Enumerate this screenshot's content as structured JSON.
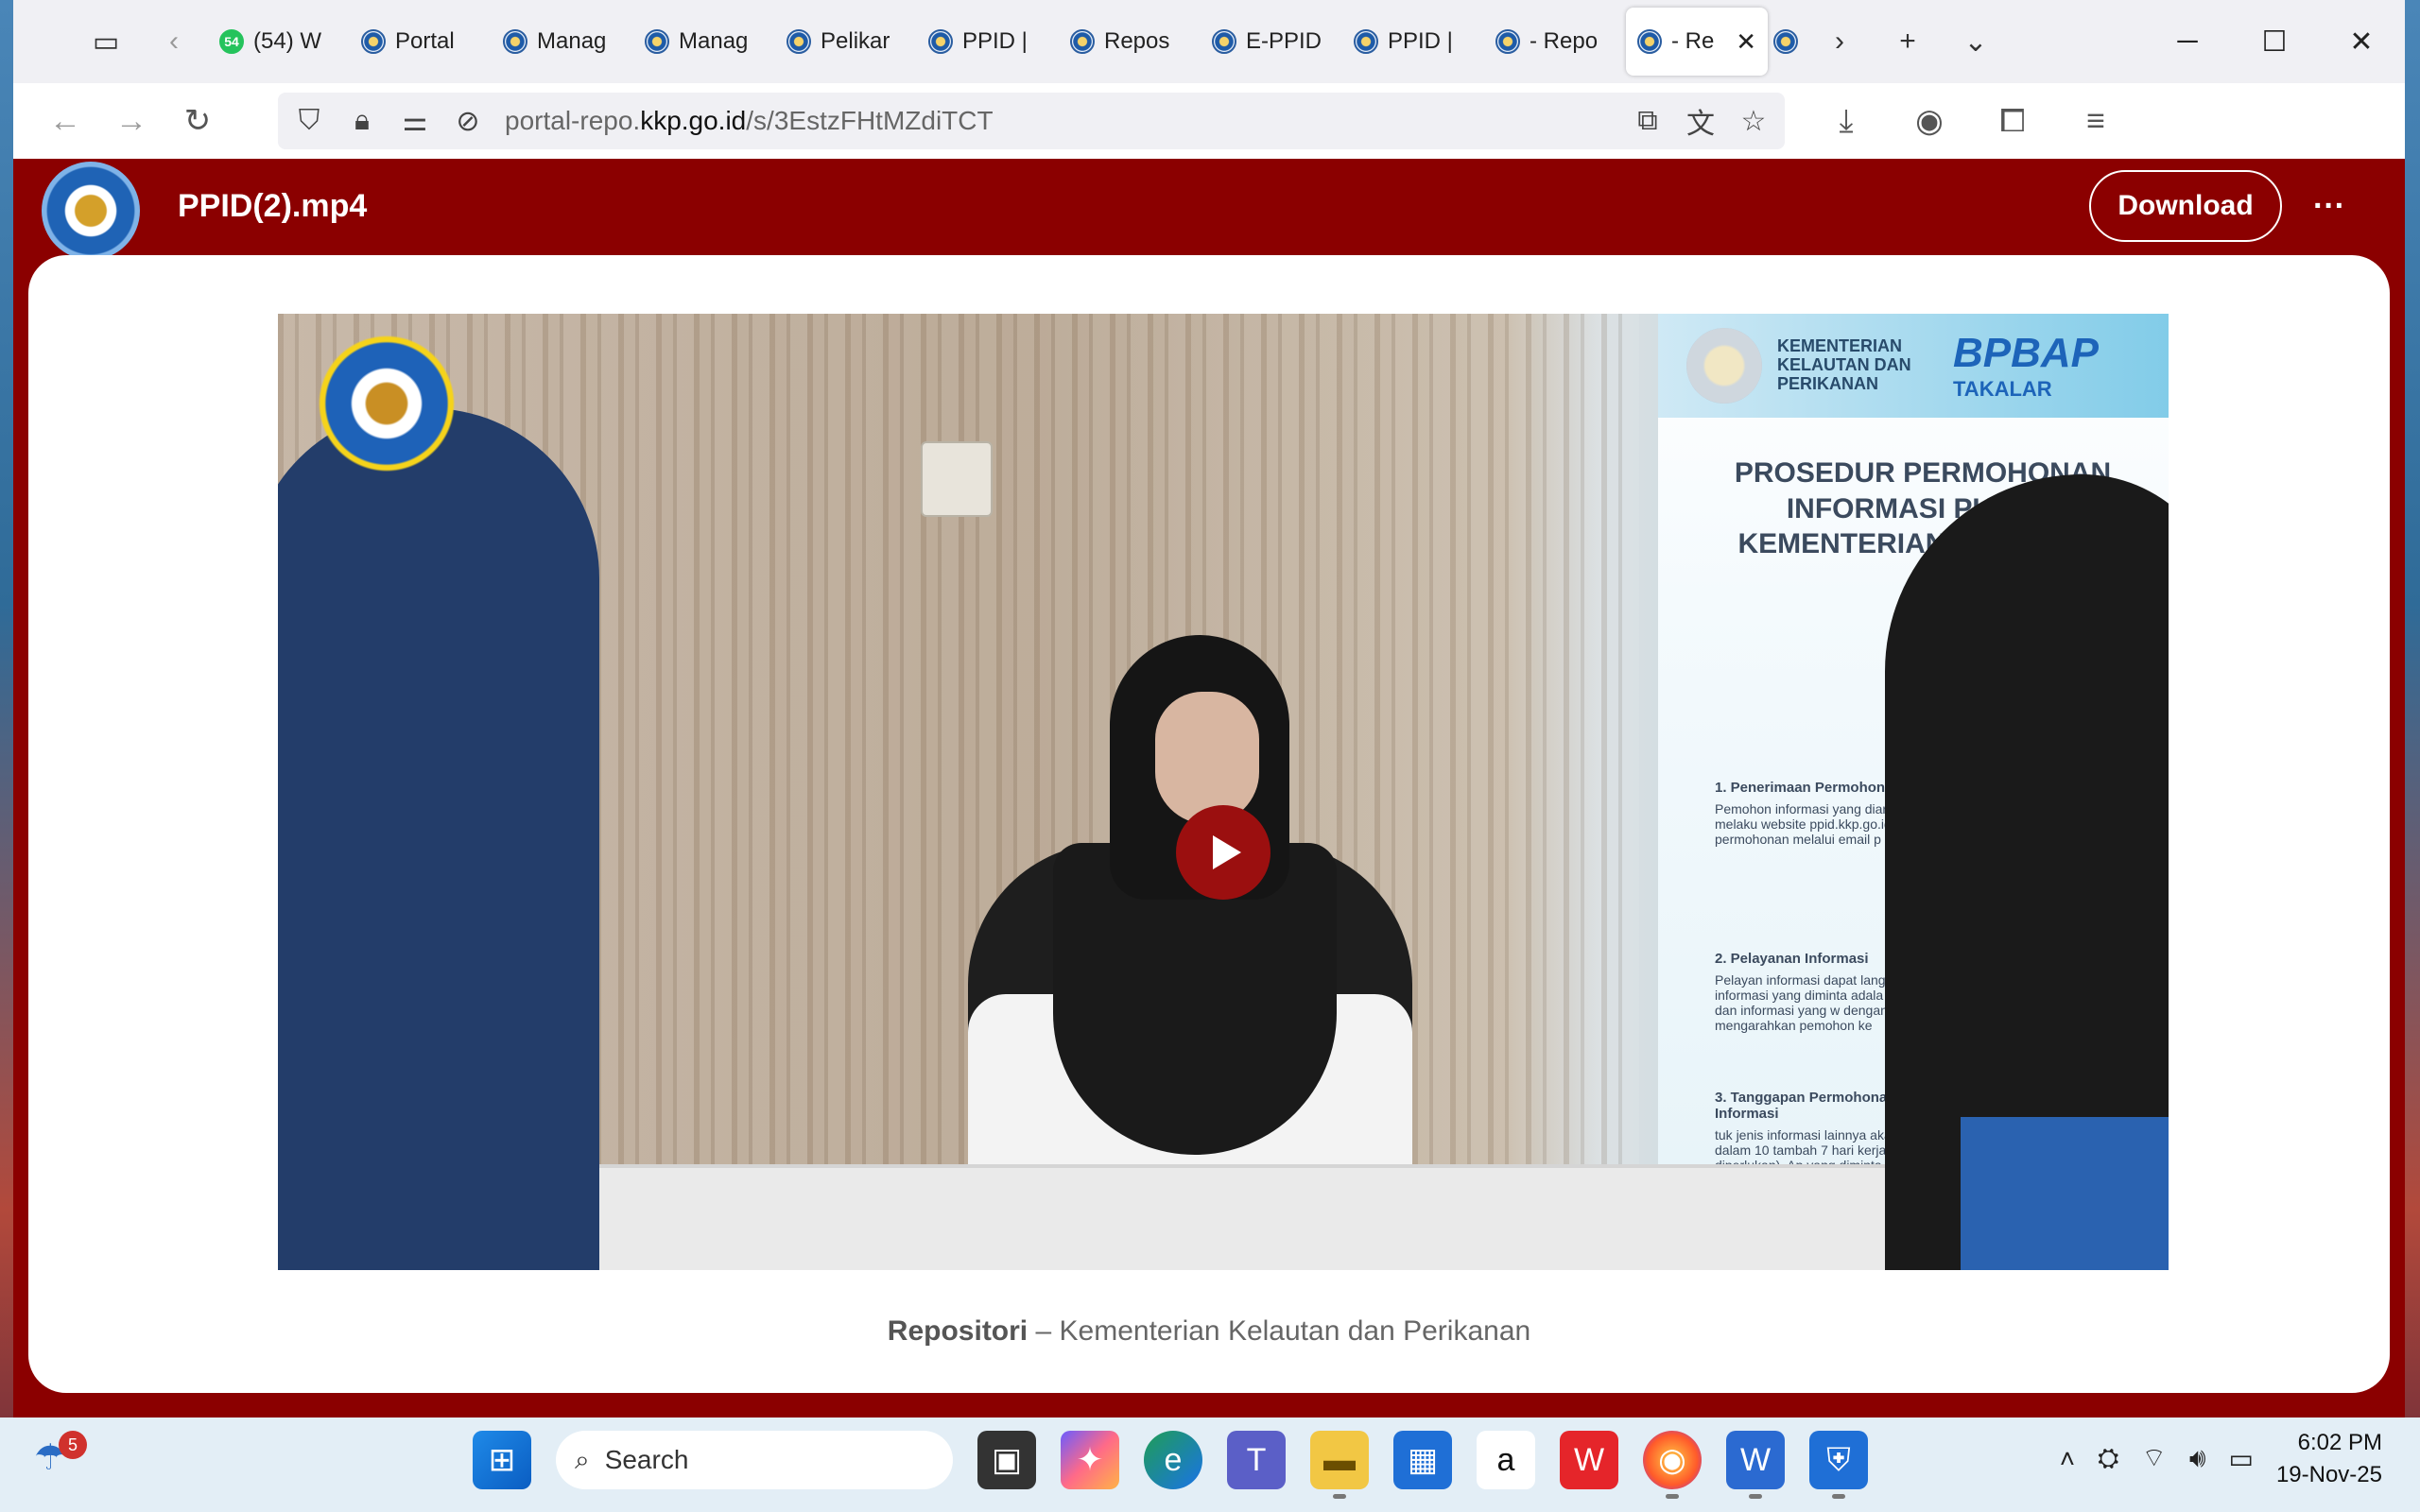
{
  "browser": {
    "tabs": [
      {
        "label": "(54) W",
        "icon": "whatsapp",
        "badge": "54",
        "active": false
      },
      {
        "label": "Portal",
        "icon": "kkp-logo",
        "active": false
      },
      {
        "label": "Manag",
        "icon": "kkp-logo",
        "active": false
      },
      {
        "label": "Manag",
        "icon": "kkp-logo",
        "active": false
      },
      {
        "label": "Pelikar",
        "icon": "kkp-logo",
        "active": false
      },
      {
        "label": "PPID |",
        "icon": "kkp-logo",
        "active": false
      },
      {
        "label": "Repos",
        "icon": "kkp-logo",
        "active": false
      },
      {
        "label": "E-PPID",
        "icon": "kkp-logo",
        "active": false
      },
      {
        "label": "PPID |",
        "icon": "kkp-logo",
        "active": false
      },
      {
        "label": "- Repo",
        "icon": "kkp-logo",
        "active": false
      },
      {
        "label": "- Re",
        "icon": "kkp-logo",
        "active": true
      }
    ],
    "url_prefix": "portal-repo.",
    "url_domain": "kkp.go.id",
    "url_path": "/s/3EstzFHtMZdiTCT"
  },
  "page": {
    "title": "PPID(2).mp4",
    "download_label": "Download",
    "more_label": "···",
    "caption_bold": "Repositori",
    "caption_rest": " – Kementerian Kelautan dan Perikanan"
  },
  "video": {
    "banner_org": "KEMENTERIAN KELAUTAN DAN PERIKANAN",
    "banner_brand": "BPBAP",
    "banner_sub": "TAKALAR",
    "banner_heading": "PROSEDUR PERMOHONAN INFORMASI PUBLIK KEMENTERIAN KELAUTAN",
    "step1_title": "1. Penerimaan Permohonan",
    "step1_text": "Pemohon informasi yang diarahkan untuk melaku website ppid.kkp.go.id. Per permohonan melalui email p",
    "step2_title": "2. Pelayanan Informasi",
    "step2_text": "Pelayan informasi dapat langsu jika informasi yang diminta adala serta merta dan informasi yang w dengan mengarahkan pemohon ke",
    "step3_title": "3. Tanggapan Permohonan Informasi",
    "step3_text": "tuk jenis informasi lainnya akan diproses dalam 10 tambah 7 hari kerja apabila diperlukan). Ap yang diminta termasuk dalam informasi maka informasi tidak dapat di",
    "overlay_logo_text": "KEMENTERIAN KELAUTAN DAN PERIKANAN"
  },
  "taskbar": {
    "weather_badge": "5",
    "search_placeholder": "Search",
    "time": "6:02 PM",
    "date": "19-Nov-25"
  }
}
